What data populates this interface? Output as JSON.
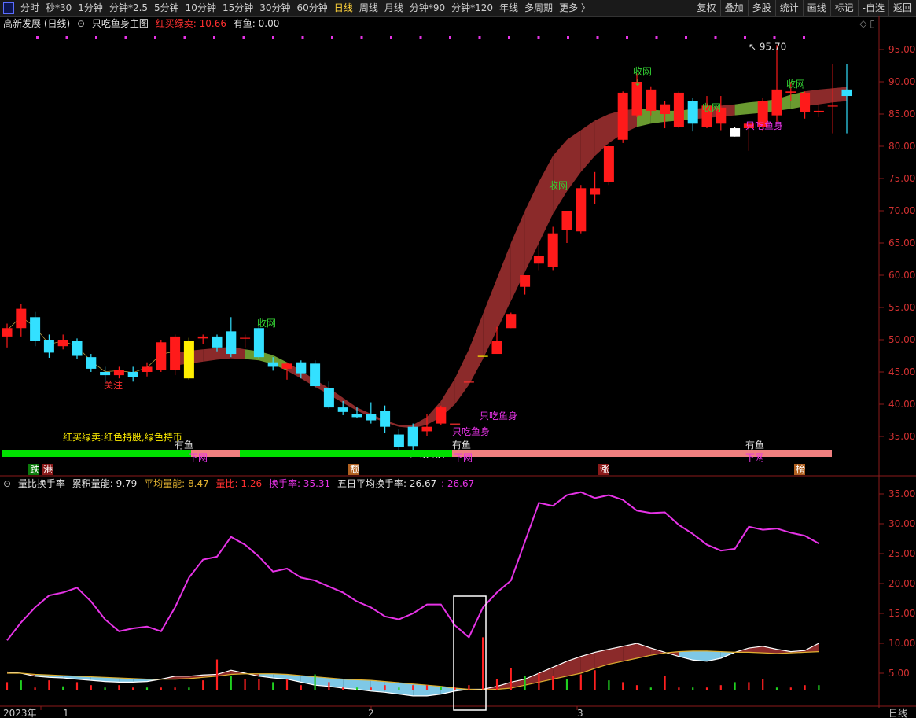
{
  "toolbar": {
    "periods": [
      "分时",
      "秒*30",
      "1分钟",
      "分钟*2.5",
      "5分钟",
      "10分钟",
      "15分钟",
      "30分钟",
      "60分钟",
      "日线",
      "周线",
      "月线",
      "分钟*90",
      "分钟*120",
      "年线",
      "多周期",
      "更多 〉"
    ],
    "active_period": "日线",
    "tools": [
      "复权",
      "叠加",
      "多股",
      "统计",
      "画线",
      "标记",
      "-自选",
      "返回"
    ]
  },
  "main_legend": {
    "stock": "高新发展 (日线)",
    "indicator": "只吃鱼身主图",
    "signal_label": "红买绿卖: 10.66",
    "fish_label": "有鱼: 0.00"
  },
  "sub_legend": {
    "name": "量比换手率",
    "cum": "累积量能: 9.79",
    "avg": "平均量能: 8.47",
    "ratio": "量比: 1.26",
    "turnover": "换手率: 35.31",
    "five_day": "五日平均换手率: 26.67",
    "five_day_val": ": 26.67"
  },
  "colors": {
    "up": "#ff1a1a",
    "down": "#33e0ff",
    "magenta": "#e633e6",
    "band_red": "#8b2a2a",
    "band_green": "#6a9a30",
    "bg": "#000000"
  },
  "chart_data": {
    "type": "candlestick",
    "x_axis_labels": [
      "2023年",
      "1",
      "2",
      "3",
      "日线"
    ],
    "price_ticks": [
      35,
      40,
      45,
      50,
      55,
      60,
      65,
      70,
      75,
      80,
      85,
      90,
      95
    ],
    "price_labels": [
      "35.00",
      "40.00",
      "45.00",
      "50.00",
      "55.00",
      "60.00",
      "65.00",
      "70.00",
      "75.00",
      "80.00",
      "85.00",
      "90.00",
      "95.00"
    ],
    "high_label": "95.70",
    "low_label": "32.07",
    "candles": [
      [
        50.5,
        51.8,
        52.5,
        48.8
      ],
      [
        51.8,
        54.8,
        55.5,
        50.5
      ],
      [
        53.5,
        49.8,
        54.3,
        49.0
      ],
      [
        50.0,
        48.0,
        50.8,
        47.2
      ],
      [
        49.0,
        50.0,
        50.8,
        48.5
      ],
      [
        49.8,
        47.5,
        50.2,
        47.0
      ],
      [
        47.3,
        45.5,
        47.8,
        45.0
      ],
      [
        45.0,
        44.5,
        45.8,
        43.3
      ],
      [
        44.5,
        45.3,
        45.8,
        44.0
      ],
      [
        45.0,
        44.2,
        45.8,
        43.5
      ],
      [
        45.0,
        45.8,
        46.5,
        44.3
      ],
      [
        45.3,
        49.6,
        50.0,
        45.0
      ],
      [
        45.3,
        50.5,
        50.8,
        44.5
      ],
      [
        44.0,
        49.8,
        50.3,
        43.8
      ],
      [
        50.2,
        50.5,
        50.8,
        49.3
      ],
      [
        50.5,
        48.8,
        50.8,
        48.2
      ],
      [
        51.3,
        47.8,
        53.5,
        47.3
      ],
      [
        50.3,
        50.3,
        50.8,
        48.8
      ],
      [
        51.8,
        47.3,
        52.2,
        47.0
      ],
      [
        46.5,
        45.8,
        47.3,
        45.2
      ],
      [
        45.5,
        46.3,
        46.5,
        43.8
      ],
      [
        46.5,
        44.8,
        46.8,
        44.0
      ],
      [
        46.3,
        42.8,
        46.8,
        42.5
      ],
      [
        42.5,
        39.5,
        43.5,
        39.3
      ],
      [
        39.5,
        38.8,
        40.5,
        38.3
      ],
      [
        38.5,
        38.0,
        39.5,
        37.8
      ],
      [
        38.5,
        37.5,
        40.3,
        37.0
      ],
      [
        39.0,
        36.5,
        39.8,
        35.5
      ],
      [
        35.3,
        33.3,
        36.2,
        32.8
      ],
      [
        36.5,
        33.5,
        37.0,
        32.1
      ],
      [
        35.8,
        36.5,
        38.5,
        35.0
      ],
      [
        37.0,
        39.5,
        39.8,
        36.8
      ],
      [
        37.0,
        37.0,
        37.0,
        37.0
      ],
      [
        43.5,
        43.5,
        43.5,
        43.5
      ],
      [
        47.5,
        47.5,
        47.5,
        47.5
      ],
      [
        47.8,
        49.8,
        52.0,
        47.8
      ],
      [
        51.8,
        54.0,
        54.2,
        51.8
      ],
      [
        58.2,
        60.0,
        60.0,
        57.0
      ],
      [
        61.8,
        63.0,
        64.8,
        60.8
      ],
      [
        61.3,
        66.5,
        67.5,
        60.8
      ],
      [
        67.0,
        70.0,
        70.0,
        65.0
      ],
      [
        66.8,
        73.5,
        74.0,
        66.5
      ],
      [
        72.5,
        73.5,
        76.0,
        71.0
      ],
      [
        74.5,
        80.0,
        80.3,
        74.0
      ],
      [
        81.0,
        88.3,
        88.5,
        80.5
      ],
      [
        84.8,
        90.0,
        91.3,
        84.5
      ],
      [
        85.5,
        88.8,
        89.3,
        84.8
      ],
      [
        85.0,
        86.5,
        87.0,
        82.8
      ],
      [
        83.0,
        88.3,
        88.5,
        82.8
      ],
      [
        87.0,
        83.5,
        87.5,
        82.3
      ],
      [
        83.0,
        86.3,
        87.8,
        82.8
      ],
      [
        83.5,
        86.0,
        87.8,
        82.5
      ],
      [
        81.5,
        82.8,
        83.0,
        81.5
      ],
      [
        82.8,
        83.5,
        83.8,
        79.3
      ],
      [
        83.0,
        87.0,
        87.5,
        82.3
      ],
      [
        84.8,
        88.8,
        95.7,
        83.8
      ],
      [
        88.3,
        88.5,
        90.0,
        87.0
      ],
      [
        85.3,
        88.3,
        88.5,
        84.3
      ],
      [
        85.5,
        85.5,
        86.5,
        84.5
      ],
      [
        86.3,
        86.3,
        92.8,
        82.0
      ],
      [
        88.8,
        87.8,
        92.8,
        82.0
      ]
    ],
    "cloud_start_index": 12,
    "cloud_upper": [
      48.0,
      48.3,
      48.5,
      48.7,
      48.9,
      48.5,
      48.2,
      47.6,
      46.5,
      45.2,
      43.8,
      42.5,
      41.0,
      39.5,
      38.5,
      37.5,
      36.8,
      36.8,
      38.0,
      40.5,
      44.0,
      48.5,
      54.0,
      59.5,
      65.0,
      70.0,
      74.5,
      78.5,
      81.0,
      82.5,
      84.0,
      85.0,
      85.6,
      85.8,
      85.7,
      85.5,
      85.5,
      85.8,
      86.0,
      86.3,
      86.5,
      86.8,
      87.0,
      87.3,
      88.0,
      88.5,
      88.8,
      89.0,
      89.2
    ],
    "cloud_lower": [
      46.0,
      46.3,
      46.6,
      46.9,
      47.1,
      47.0,
      46.8,
      46.2,
      45.2,
      44.0,
      42.7,
      41.5,
      40.2,
      39.0,
      38.0,
      37.2,
      36.5,
      36.3,
      36.8,
      38.0,
      40.0,
      43.0,
      47.0,
      51.5,
      56.0,
      60.5,
      65.0,
      69.5,
      73.0,
      76.0,
      78.5,
      80.5,
      82.0,
      83.0,
      83.5,
      83.8,
      84.0,
      84.2,
      84.4,
      84.6,
      84.8,
      85.0,
      85.2,
      85.5,
      85.8,
      86.2,
      86.5,
      86.8,
      87.0
    ],
    "turnover_rate": [
      10.5,
      13.5,
      16.0,
      18.0,
      18.5,
      19.3,
      17.0,
      14.0,
      12.0,
      12.5,
      12.8,
      12.0,
      16.0,
      21.0,
      24.0,
      24.5,
      27.8,
      26.5,
      24.5,
      22.0,
      22.5,
      21.0,
      20.5,
      19.5,
      18.5,
      17.0,
      16.0,
      14.5,
      14.0,
      15.0,
      16.5,
      16.5,
      13.0,
      11.0,
      16.0,
      18.5,
      20.5,
      27.0,
      33.5,
      33.0,
      34.8,
      35.3,
      34.3,
      34.8,
      34.0,
      32.2,
      31.8,
      31.9,
      29.8,
      28.3,
      26.5,
      25.5,
      25.8,
      29.5,
      29.0,
      29.2,
      28.5,
      28.0,
      26.7
    ],
    "volume_ratio": [
      3.5,
      3.8,
      2.5,
      3.8,
      2.8,
      3.5,
      3.0,
      1.0,
      3.0,
      1.5,
      1.0,
      2.0,
      1.5,
      2.5,
      3.8,
      7.3,
      4.5,
      4.0,
      4.0,
      3.5,
      4.0,
      3.0,
      4.8,
      3.5,
      1.0,
      1.0,
      2.5,
      3.0,
      2.5,
      3.0,
      3.0,
      2.8,
      2.2,
      3.0,
      2.5,
      4.0,
      5.8,
      4.5,
      5.0,
      4.5,
      4.0,
      4.8,
      5.5,
      3.8,
      3.5,
      3.0,
      2.0,
      4.5,
      2.5,
      2.2,
      2.5,
      3.0,
      3.5,
      3.5,
      4.0,
      2.5,
      2.5,
      3.0,
      3.0
    ],
    "vol_ticks": [
      5,
      10,
      15,
      20,
      25,
      30,
      35
    ],
    "vol_labels": [
      "5.00",
      "10.00",
      "15.00",
      "20.00",
      "25.00",
      "30.00",
      "35.00"
    ]
  },
  "annotations": {
    "buy_sell_note": "红买绿卖:红色持股,绿色持币",
    "net_labels": [
      "收网",
      "收网",
      "收网",
      "收网",
      "收网"
    ],
    "fish_body_labels": [
      "只吃鱼身",
      "只吃鱼身",
      "只吃鱼身"
    ],
    "has_fish": [
      "有鱼",
      "有鱼",
      "有鱼"
    ],
    "down_net": [
      "下网",
      "下网",
      "下网"
    ],
    "attention": "关注",
    "bottom_tags": [
      "跌",
      "港",
      "颓",
      "涨",
      "榜"
    ]
  }
}
